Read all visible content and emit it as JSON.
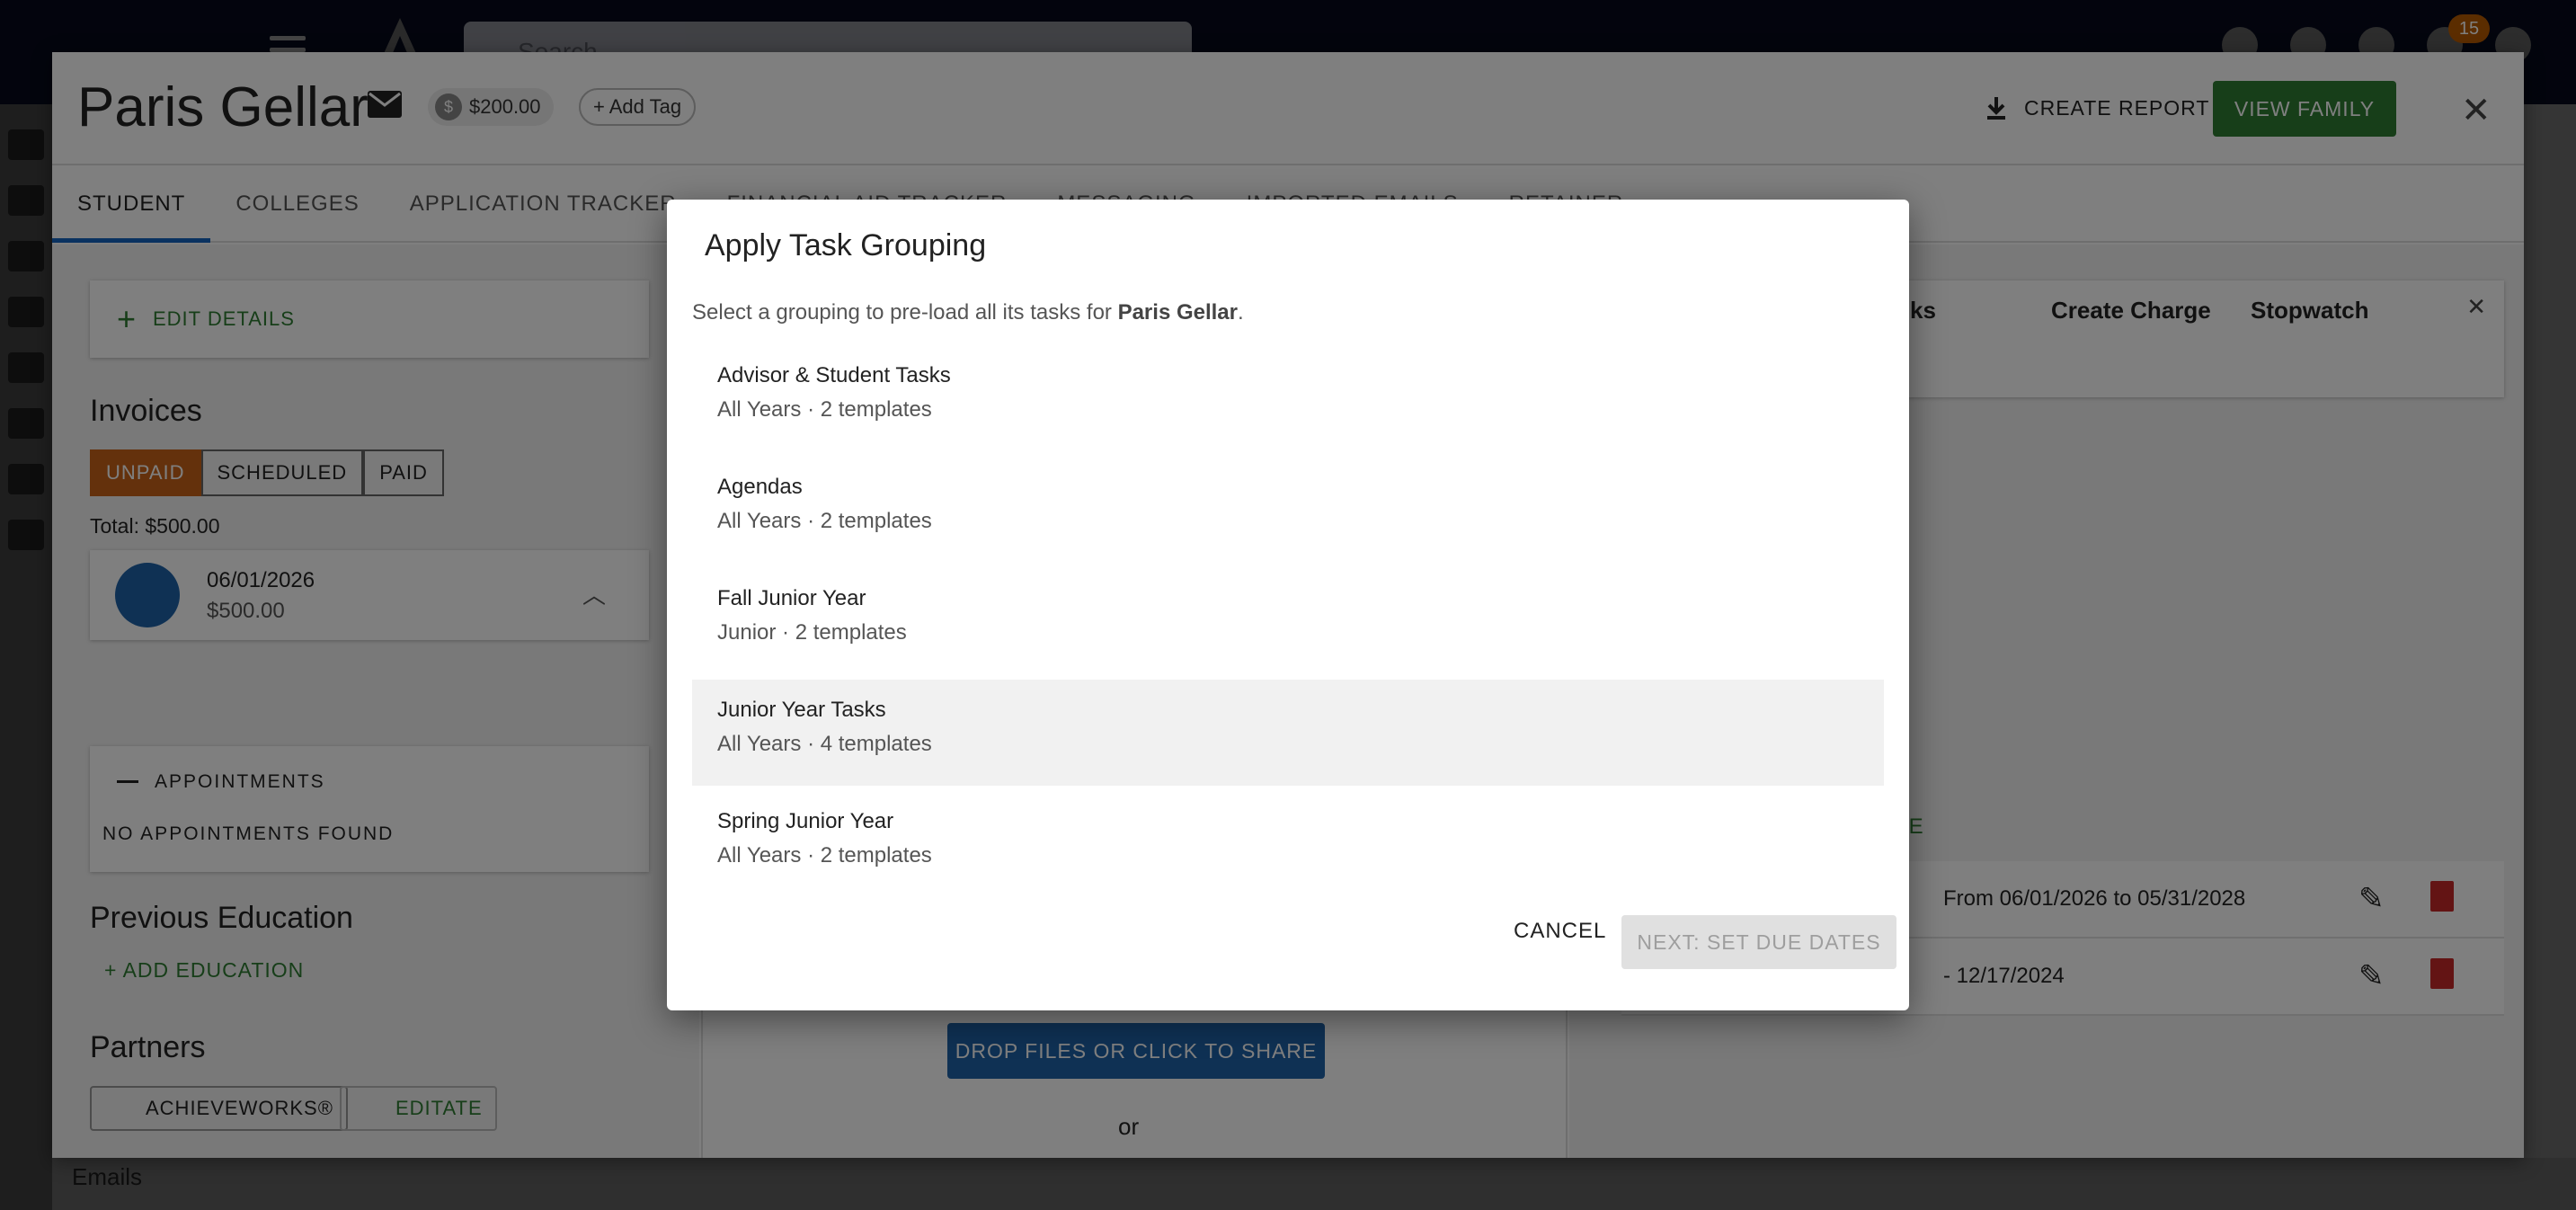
{
  "topbar": {
    "search_placeholder": "Search",
    "notification_count": "15"
  },
  "sidebar": {
    "emails_label": "Emails"
  },
  "student": {
    "name": "Paris Gellar",
    "balance": "$200.00",
    "add_tag_label": "Add Tag",
    "create_report_label": "CREATE REPORT",
    "view_family_label": "VIEW FAMILY"
  },
  "tabs": [
    {
      "label": "STUDENT"
    },
    {
      "label": "COLLEGES"
    },
    {
      "label": "APPLICATION TRACKER"
    },
    {
      "label": "FINANCIAL AID TRACKER"
    },
    {
      "label": "MESSAGING"
    },
    {
      "label": "IMPORTED EMAILS"
    },
    {
      "label": "RETAINER"
    }
  ],
  "left": {
    "edit_details_label": "EDIT DETAILS",
    "invoices_title": "Invoices",
    "invoice_filters": [
      "UNPAID",
      "SCHEDULED",
      "PAID"
    ],
    "total": "Total: $500.00",
    "invoice": {
      "date": "06/01/2026",
      "amount": "$500.00"
    },
    "appointments_title": "APPOINTMENTS",
    "appointments_empty": "NO APPOINTMENTS FOUND",
    "previous_education_title": "Previous Education",
    "add_education_label": "ADD EDUCATION",
    "partners_title": "Partners",
    "partners": [
      "ACHIEVEWORKS®",
      "EDITATE"
    ]
  },
  "middle": {
    "drop_files_label": "DROP FILES OR CLICK TO SHARE",
    "or_label": "or"
  },
  "right": {
    "quick_actions": [
      "Links",
      "Create Charge",
      "Stopwatch"
    ],
    "charge_link_label": "GE",
    "charge_rows": [
      {
        "text": "From 06/01/2026 to 05/31/2028"
      },
      {
        "text": "- 12/17/2024"
      }
    ]
  },
  "dialog": {
    "title": "Apply Task Grouping",
    "subtitle_prefix": "Select a grouping to pre-load all its tasks for ",
    "subtitle_student": "Paris Gellar",
    "subtitle_suffix": ".",
    "groupings": [
      {
        "name": "Advisor & Student Tasks",
        "meta": "All Years · 2 templates"
      },
      {
        "name": "Agendas",
        "meta": "All Years · 2 templates"
      },
      {
        "name": "Fall Junior Year",
        "meta": "Junior · 2 templates"
      },
      {
        "name": "Junior Year Tasks",
        "meta": "All Years · 4 templates"
      },
      {
        "name": "Spring Junior Year",
        "meta": "All Years · 2 templates"
      }
    ],
    "cancel_label": "CANCEL",
    "next_label": "NEXT: SET DUE DATES"
  },
  "colors": {
    "primary_green": "#2e7d32",
    "accent_orange": "#c96318",
    "primary_blue": "#1e63a8",
    "delete_red": "#c62828"
  }
}
